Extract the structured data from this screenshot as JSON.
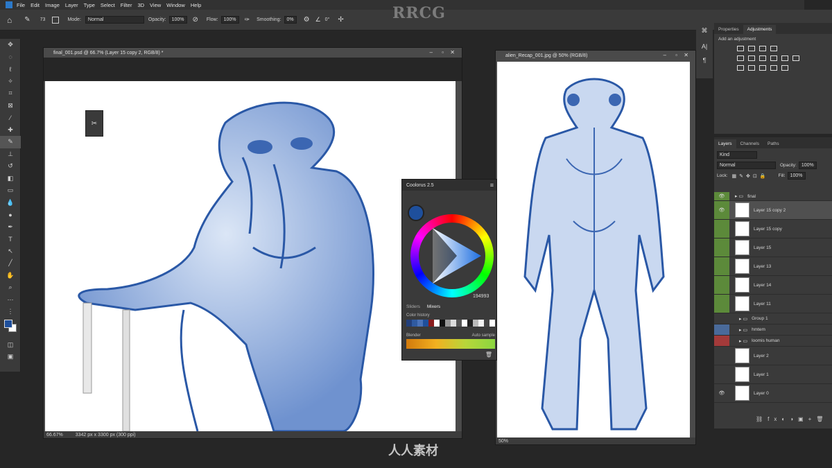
{
  "menu": [
    "File",
    "Edit",
    "Image",
    "Layer",
    "Type",
    "Select",
    "Filter",
    "3D",
    "View",
    "Window",
    "Help"
  ],
  "options": {
    "brush_size": "73",
    "mode_label": "Mode:",
    "mode_value": "Normal",
    "opacity_label": "Opacity:",
    "opacity_value": "100%",
    "flow_label": "Flow:",
    "flow_value": "100%",
    "smoothing_label": "Smoothing:",
    "smoothing_value": "0%",
    "angle_value": "0°"
  },
  "doc1": {
    "title": "final_001.psd @ 66.7% (Layer 15 copy 2, RGB/8) *",
    "zoom": "66.67%",
    "size": "3342 px x 3300 px (300 ppi)"
  },
  "doc2": {
    "title": "alien_Recap_001.jpg @ 50% (RGB/8)",
    "zoom": "50%"
  },
  "coolorus": {
    "title": "Coolorus 2.5",
    "hex": "194993",
    "tab_sliders": "Sliders",
    "tab_mixers": "Mixers",
    "color_history": "Color history",
    "blender": "Blender",
    "auto_sample": "Auto sample",
    "swatch_current": "#1e4f9c",
    "swatch_history": [
      "#233f7a",
      "#2f5aa0",
      "#4a72b8",
      "#1e4f9c",
      "#8a1c1c",
      "#ffffff",
      "#111111",
      "#999999",
      "#dddddd",
      "#555555",
      "#ffffff",
      "#222222",
      "#bbbbbb",
      "#f2f2f2",
      "#444444",
      "#ffffff"
    ]
  },
  "properties": {
    "tab_properties": "Properties",
    "tab_adjustments": "Adjustments",
    "add_adjustment": "Add an adjustment"
  },
  "layers": {
    "tab_layers": "Layers",
    "tab_channels": "Channels",
    "tab_paths": "Paths",
    "kind": "Kind",
    "blend": "Normal",
    "opacity_label": "Opacity:",
    "opacity_value": "100%",
    "lock_label": "Lock:",
    "fill_label": "Fill:",
    "fill_value": "100%",
    "items": [
      {
        "name": "final",
        "type": "group"
      },
      {
        "name": "Layer 15 copy 2",
        "type": "layer"
      },
      {
        "name": "Layer 15 copy",
        "type": "layer"
      },
      {
        "name": "Layer 15",
        "type": "layer"
      },
      {
        "name": "Layer 13",
        "type": "layer"
      },
      {
        "name": "Layer 14",
        "type": "layer"
      },
      {
        "name": "Layer 11",
        "type": "layer"
      },
      {
        "name": "Group 1",
        "type": "group"
      },
      {
        "name": "hmtem",
        "type": "group"
      },
      {
        "name": "loomis human",
        "type": "group"
      },
      {
        "name": "Layer 2",
        "type": "layer"
      },
      {
        "name": "Layer 1",
        "type": "layer"
      },
      {
        "name": "Layer 0",
        "type": "layer"
      }
    ]
  },
  "watermark": {
    "logo": "RRCG",
    "site": "人人素材",
    "cn": "人人素材"
  },
  "colors": {
    "accent": "#1e4f9c",
    "green_tag": "#5c8a3a",
    "blue_tag": "#4a6a9a",
    "red_tag": "#a33a3a"
  }
}
